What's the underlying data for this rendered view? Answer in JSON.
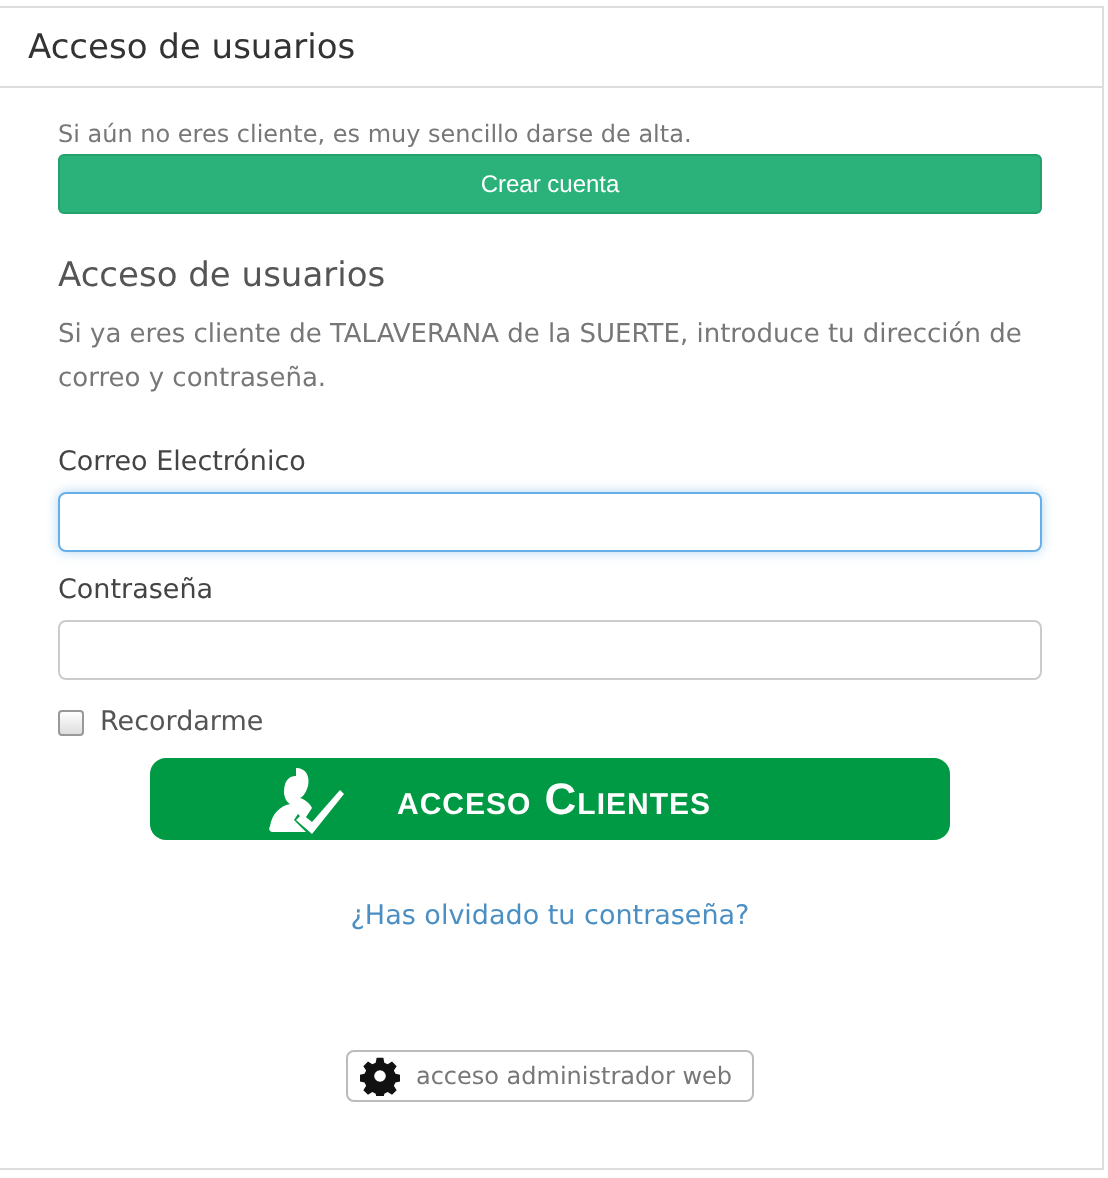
{
  "panel": {
    "title": "Acceso de usuarios"
  },
  "signup": {
    "text": "Si aún no eres cliente, es muy sencillo darse de alta.",
    "button": "Crear cuenta"
  },
  "login": {
    "heading": "Acceso de usuarios",
    "intro": "Si ya eres cliente de TALAVERANA de la SUERTE, introduce tu dirección de correo y contraseña.",
    "fields": [
      {
        "label": "Correo Electrónico",
        "focused": true
      },
      {
        "label": "Contraseña",
        "focused": false
      }
    ],
    "remember": {
      "label": "Recordarme",
      "checked": false
    },
    "submit": "acceso Clientes",
    "forgot_link": "¿Has olvidado tu contraseña?",
    "admin_button": "acceso administrador web"
  }
}
